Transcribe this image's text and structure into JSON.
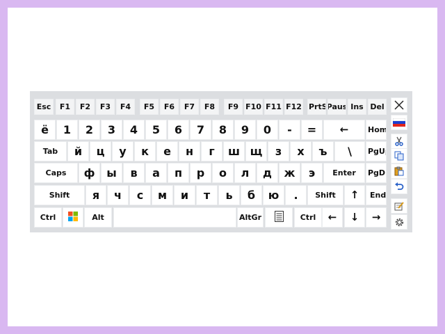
{
  "keyboard": {
    "fn_row": [
      "Esc",
      "F1",
      "F2",
      "F3",
      "F4",
      "F5",
      "F6",
      "F7",
      "F8",
      "F9",
      "F10",
      "F11",
      "F12",
      "PrtSc",
      "Paus",
      "Ins",
      "Del"
    ],
    "num_row": [
      "ё",
      "1",
      "2",
      "3",
      "4",
      "5",
      "6",
      "7",
      "8",
      "9",
      "0",
      "-",
      "=",
      "←",
      "Home"
    ],
    "row_q": [
      "Tab",
      "й",
      "ц",
      "у",
      "к",
      "е",
      "н",
      "г",
      "ш",
      "щ",
      "з",
      "х",
      "ъ",
      "\\",
      "PgUp"
    ],
    "row_a": [
      "Caps",
      "ф",
      "ы",
      "в",
      "а",
      "п",
      "р",
      "о",
      "л",
      "д",
      "ж",
      "э",
      "Enter",
      "PgDn"
    ],
    "row_z": [
      "Shift",
      "я",
      "ч",
      "с",
      "м",
      "и",
      "т",
      "ь",
      "б",
      "ю",
      ".",
      "Shift",
      "↑",
      "End"
    ],
    "row_bottom": [
      "Ctrl",
      "",
      "Alt",
      "",
      "AltGr",
      "",
      "Ctrl",
      "←",
      "↓",
      "→"
    ]
  },
  "side_icons": [
    "close-icon",
    "language-flag-icon",
    "cut-icon",
    "copy-icon",
    "paste-icon",
    "undo-icon",
    "edit-icon",
    "settings-icon"
  ],
  "colors": {
    "frame": "#d9b8f1",
    "keyboard_bg": "#dcdee1",
    "key_bg": "#ffffff",
    "fkey_bg": "#f3f4f5"
  }
}
